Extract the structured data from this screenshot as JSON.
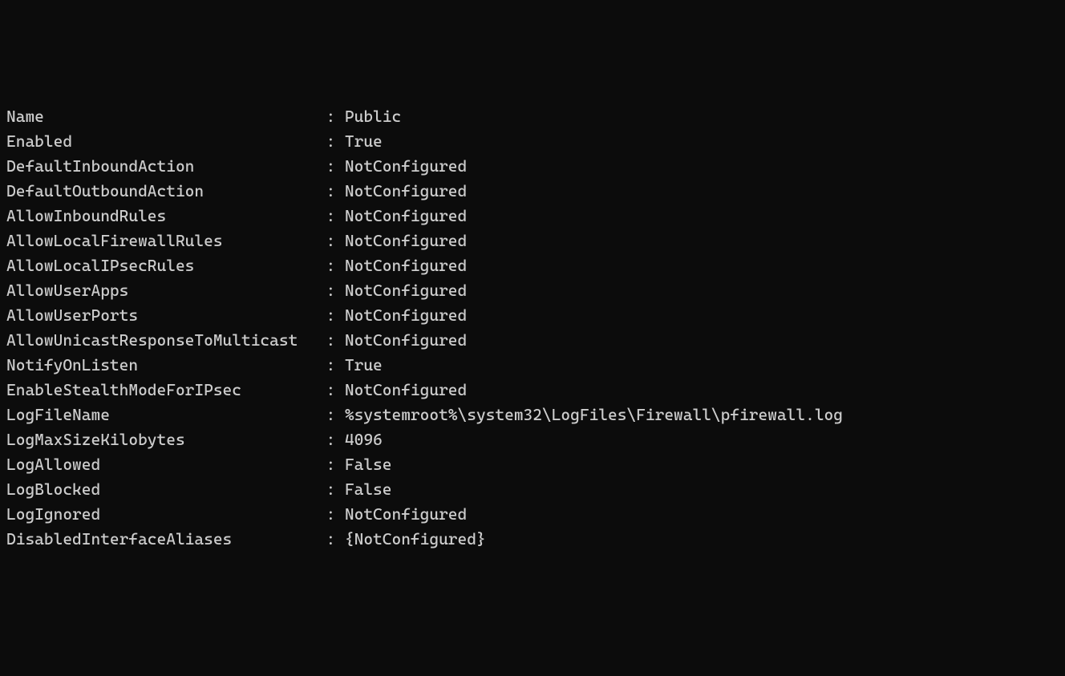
{
  "separator": " : ",
  "properties": [
    {
      "key": "Name",
      "value": "Public"
    },
    {
      "key": "Enabled",
      "value": "True"
    },
    {
      "key": "DefaultInboundAction",
      "value": "NotConfigured"
    },
    {
      "key": "DefaultOutboundAction",
      "value": "NotConfigured"
    },
    {
      "key": "AllowInboundRules",
      "value": "NotConfigured"
    },
    {
      "key": "AllowLocalFirewallRules",
      "value": "NotConfigured"
    },
    {
      "key": "AllowLocalIPsecRules",
      "value": "NotConfigured"
    },
    {
      "key": "AllowUserApps",
      "value": "NotConfigured"
    },
    {
      "key": "AllowUserPorts",
      "value": "NotConfigured"
    },
    {
      "key": "AllowUnicastResponseToMulticast",
      "value": "NotConfigured"
    },
    {
      "key": "NotifyOnListen",
      "value": "True"
    },
    {
      "key": "EnableStealthModeForIPsec",
      "value": "NotConfigured"
    },
    {
      "key": "LogFileName",
      "value": "%systemroot%\\system32\\LogFiles\\Firewall\\pfirewall.log"
    },
    {
      "key": "LogMaxSizeKilobytes",
      "value": "4096"
    },
    {
      "key": "LogAllowed",
      "value": "False"
    },
    {
      "key": "LogBlocked",
      "value": "False"
    },
    {
      "key": "LogIgnored",
      "value": "NotConfigured"
    },
    {
      "key": "DisabledInterfaceAliases",
      "value": "{NotConfigured}"
    }
  ]
}
